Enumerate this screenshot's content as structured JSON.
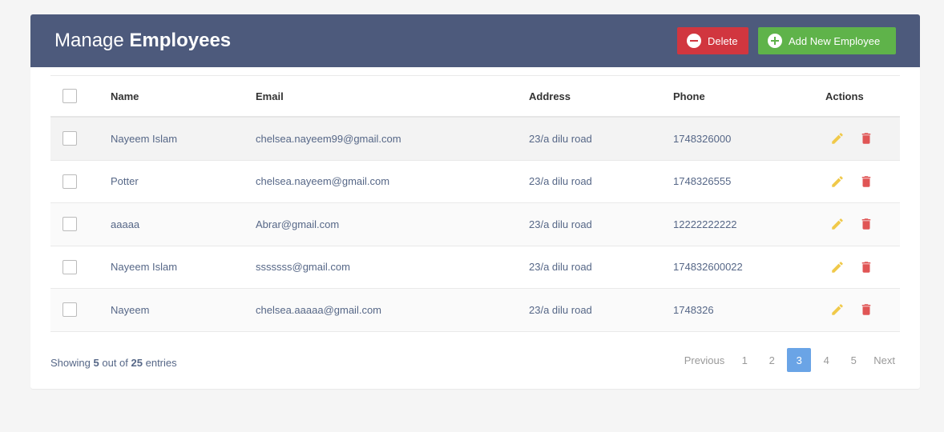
{
  "header": {
    "title_prefix": "Manage",
    "title_bold": "Employees",
    "delete_label": "Delete",
    "add_label": "Add New Employee"
  },
  "table": {
    "columns": {
      "name": "Name",
      "email": "Email",
      "address": "Address",
      "phone": "Phone",
      "actions": "Actions"
    },
    "rows": [
      {
        "name": "Nayeem Islam",
        "email": "chelsea.nayeem99@gmail.com",
        "address": "23/a dilu road",
        "phone": "1748326000"
      },
      {
        "name": "Potter",
        "email": "chelsea.nayeem@gmail.com",
        "address": "23/a dilu road",
        "phone": "1748326555"
      },
      {
        "name": "aaaaa",
        "email": "Abrar@gmail.com",
        "address": "23/a dilu road",
        "phone": "12222222222"
      },
      {
        "name": "Nayeem Islam",
        "email": "sssssss@gmail.com",
        "address": "23/a dilu road",
        "phone": "174832600022"
      },
      {
        "name": "Nayeem",
        "email": "chelsea.aaaaa@gmail.com",
        "address": "23/a dilu road",
        "phone": "1748326"
      }
    ]
  },
  "footer": {
    "showing_prefix": "Showing",
    "shown_count": "5",
    "out_of": "out of",
    "total_count": "25",
    "entries": "entries"
  },
  "pagination": {
    "previous": "Previous",
    "pages": [
      "1",
      "2",
      "3",
      "4",
      "5"
    ],
    "active": "3",
    "next": "Next"
  },
  "colors": {
    "header_bg": "#4d5a7c",
    "delete_btn": "#d1363f",
    "add_btn": "#5fb34a",
    "edit_icon": "#f0c94a",
    "delete_icon": "#e05555",
    "active_page": "#6aa4e6"
  },
  "icons": {
    "delete_button": "minus-circle-icon",
    "add_button": "plus-circle-icon",
    "edit": "pencil-icon",
    "remove": "trash-icon"
  }
}
